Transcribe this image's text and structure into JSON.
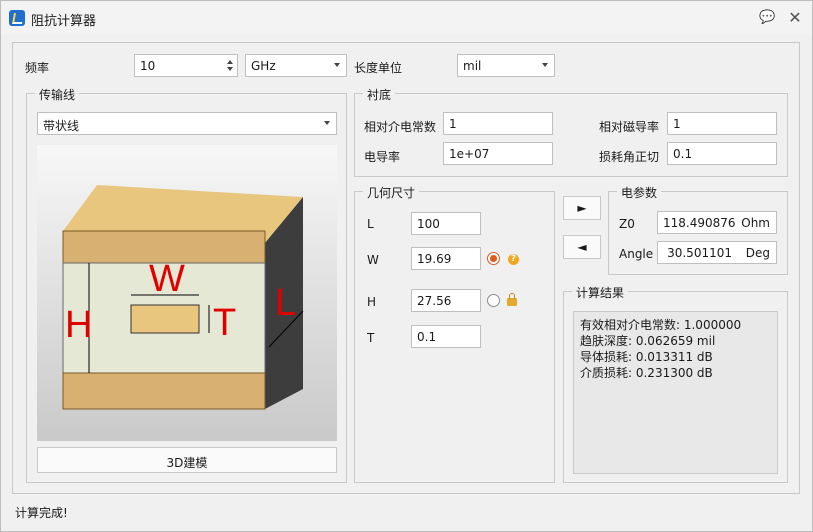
{
  "window": {
    "title": "阻抗计算器",
    "icons": [
      "app-icon",
      "help-icon",
      "close-icon"
    ]
  },
  "frequency": {
    "label": "频率",
    "value": "10",
    "unit": "GHz"
  },
  "length_unit": {
    "label": "长度单位",
    "value": "mil"
  },
  "transmission_line": {
    "title": "传输线",
    "type": "带状线",
    "diagram_labels": [
      "W",
      "T",
      "H",
      "L"
    ],
    "build_button": "3D建模"
  },
  "substrate": {
    "title": "衬底",
    "dielectric_constant": {
      "label": "相对介电常数",
      "value": "1"
    },
    "permeability": {
      "label": "相对磁导率",
      "value": "1"
    },
    "conductivity": {
      "label": "电导率",
      "value": "1e+07"
    },
    "loss_tangent": {
      "label": "损耗角正切",
      "value": "0.1"
    }
  },
  "geometry": {
    "title": "几何尺寸",
    "L": {
      "label": "L",
      "value": "100"
    },
    "W": {
      "label": "W",
      "value": "19.69"
    },
    "H": {
      "label": "H",
      "value": "27.56"
    },
    "T": {
      "label": "T",
      "value": "0.1"
    },
    "selected_solve_for": "W"
  },
  "electrical": {
    "title": "电参数",
    "z0": {
      "label": "Z0",
      "value": "118.490876",
      "unit": "Ohm"
    },
    "angle": {
      "label": "Angle",
      "value": "30.501101",
      "unit": "Deg"
    }
  },
  "arrows": {
    "synthesize": "►",
    "analyze": "◄"
  },
  "results": {
    "title": "计算结果",
    "lines": [
      "有效相对介电常数: 1.000000",
      "趋肤深度: 0.062659 mil",
      "导体损耗: 0.013311 dB",
      "介质损耗: 0.231300 dB"
    ]
  },
  "status": "计算完成!"
}
